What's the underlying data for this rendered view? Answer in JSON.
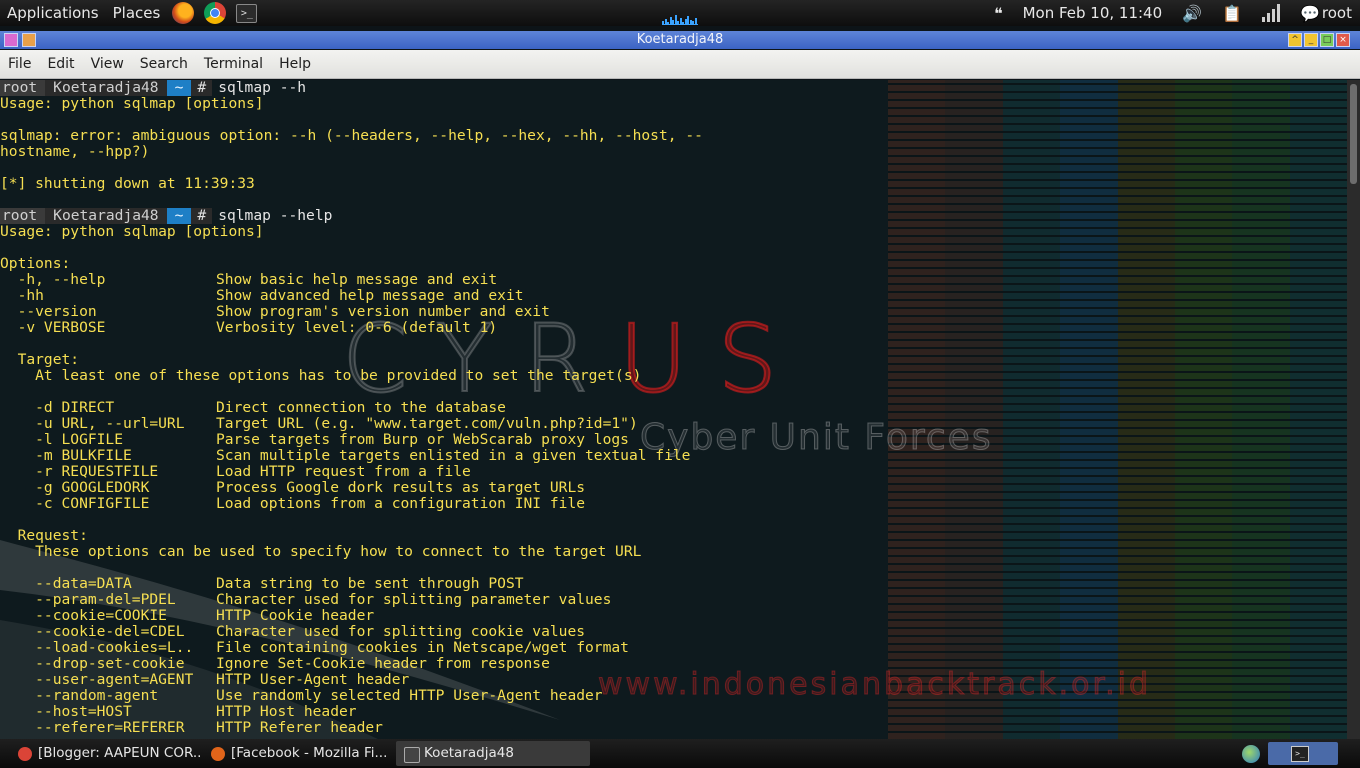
{
  "top_panel": {
    "menus": [
      "Applications",
      "Places"
    ],
    "clock": "Mon Feb 10, 11:40",
    "user": "root"
  },
  "window": {
    "title": "Koetaradja48"
  },
  "menubar": [
    "File",
    "Edit",
    "View",
    "Search",
    "Terminal",
    "Help"
  ],
  "terminal": {
    "prompt": {
      "user": "root",
      "host": "Koetaradja48",
      "dir": "~",
      "symbol": "#"
    },
    "lines": [
      {
        "type": "prompt",
        "cmd": "sqlmap --h"
      },
      {
        "type": "text",
        "text": "Usage: python sqlmap [options]"
      },
      {
        "type": "text",
        "text": ""
      },
      {
        "type": "text",
        "text": "sqlmap: error: ambiguous option: --h (--headers, --help, --hex, --hh, --host, --"
      },
      {
        "type": "text",
        "text": "hostname, --hpp?)"
      },
      {
        "type": "text",
        "text": ""
      },
      {
        "type": "text",
        "text": "[*] shutting down at 11:39:33"
      },
      {
        "type": "text",
        "text": ""
      },
      {
        "type": "prompt",
        "cmd": "sqlmap --help"
      },
      {
        "type": "text",
        "text": "Usage: python sqlmap [options]"
      },
      {
        "type": "text",
        "text": ""
      },
      {
        "type": "text",
        "text": "Options:"
      },
      {
        "type": "opt",
        "flag": "  -h, --help",
        "desc": "Show basic help message and exit"
      },
      {
        "type": "opt",
        "flag": "  -hh",
        "desc": "Show advanced help message and exit"
      },
      {
        "type": "opt",
        "flag": "  --version",
        "desc": "Show program's version number and exit"
      },
      {
        "type": "opt",
        "flag": "  -v VERBOSE",
        "desc": "Verbosity level: 0-6 (default 1)"
      },
      {
        "type": "text",
        "text": ""
      },
      {
        "type": "text",
        "text": "  Target:"
      },
      {
        "type": "text",
        "text": "    At least one of these options has to be provided to set the target(s)"
      },
      {
        "type": "text",
        "text": ""
      },
      {
        "type": "opt",
        "flag": "    -d DIRECT",
        "desc": "Direct connection to the database"
      },
      {
        "type": "opt",
        "flag": "    -u URL, --url=URL",
        "desc": "Target URL (e.g. \"www.target.com/vuln.php?id=1\")"
      },
      {
        "type": "opt",
        "flag": "    -l LOGFILE",
        "desc": "Parse targets from Burp or WebScarab proxy logs"
      },
      {
        "type": "opt",
        "flag": "    -m BULKFILE",
        "desc": "Scan multiple targets enlisted in a given textual file"
      },
      {
        "type": "opt",
        "flag": "    -r REQUESTFILE",
        "desc": "Load HTTP request from a file"
      },
      {
        "type": "opt",
        "flag": "    -g GOOGLEDORK",
        "desc": "Process Google dork results as target URLs"
      },
      {
        "type": "opt",
        "flag": "    -c CONFIGFILE",
        "desc": "Load options from a configuration INI file"
      },
      {
        "type": "text",
        "text": ""
      },
      {
        "type": "text",
        "text": "  Request:"
      },
      {
        "type": "text",
        "text": "    These options can be used to specify how to connect to the target URL"
      },
      {
        "type": "text",
        "text": ""
      },
      {
        "type": "opt",
        "flag": "    --data=DATA",
        "desc": "Data string to be sent through POST"
      },
      {
        "type": "opt",
        "flag": "    --param-del=PDEL",
        "desc": "Character used for splitting parameter values"
      },
      {
        "type": "opt",
        "flag": "    --cookie=COOKIE",
        "desc": "HTTP Cookie header"
      },
      {
        "type": "opt",
        "flag": "    --cookie-del=CDEL",
        "desc": "Character used for splitting cookie values"
      },
      {
        "type": "opt",
        "flag": "    --load-cookies=L..",
        "desc": "File containing cookies in Netscape/wget format"
      },
      {
        "type": "opt",
        "flag": "    --drop-set-cookie",
        "desc": "Ignore Set-Cookie header from response"
      },
      {
        "type": "opt",
        "flag": "    --user-agent=AGENT",
        "desc": "HTTP User-Agent header"
      },
      {
        "type": "opt",
        "flag": "    --random-agent",
        "desc": "Use randomly selected HTTP User-Agent header"
      },
      {
        "type": "opt",
        "flag": "    --host=HOST",
        "desc": "HTTP Host header"
      },
      {
        "type": "opt",
        "flag": "    --referer=REFERER",
        "desc": "HTTP Referer header"
      }
    ]
  },
  "wallpaper": {
    "logo_left": "CYR",
    "logo_red": "US",
    "tagline": "Cyber Unit Forces",
    "url": "www.indonesianbacktrack.or.id",
    "stripe_colors": [
      "#4a2a1e",
      "#3d2a22",
      "#123a3e",
      "#123e5a",
      "#3c3a12",
      "#2a4a16",
      "#1e4a22",
      "#124040"
    ]
  },
  "taskbar": {
    "tasks": [
      {
        "label": "[Blogger: AAPEUN COR...",
        "icon_color": "#db4437"
      },
      {
        "label": "[Facebook - Mozilla Fi...",
        "icon_color": "#e0641a"
      },
      {
        "label": "Koetaradja48",
        "icon_color": "#444444"
      }
    ]
  }
}
